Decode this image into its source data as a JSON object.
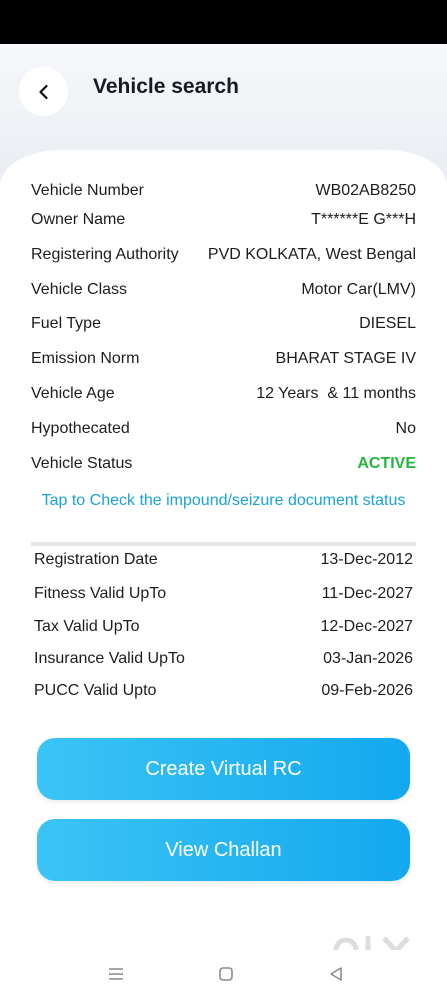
{
  "header": {
    "title": "Vehicle search"
  },
  "details": [
    {
      "label": "Vehicle Number",
      "value": "WB02AB8250"
    },
    {
      "label": "Owner Name",
      "value": "T******E G***H"
    },
    {
      "label": "Registering Authority",
      "value": "PVD KOLKATA, West Bengal"
    },
    {
      "label": "Vehicle Class",
      "value": "Motor Car(LMV)"
    },
    {
      "label": "Fuel Type",
      "value": "DIESEL"
    },
    {
      "label": "Emission Norm",
      "value": "BHARAT STAGE IV"
    },
    {
      "label": "Vehicle Age",
      "value": "12 Years  & 11 months"
    },
    {
      "label": "Hypothecated",
      "value": "No"
    },
    {
      "label": "Vehicle Status",
      "value": "ACTIVE"
    }
  ],
  "impound_link": "Tap to Check the impound/seizure document status",
  "dates": [
    {
      "label": "Registration Date",
      "value": "13-Dec-2012"
    },
    {
      "label": "Fitness Valid UpTo",
      "value": "11-Dec-2027"
    },
    {
      "label": "Tax Valid UpTo",
      "value": "12-Dec-2027"
    },
    {
      "label": "Insurance Valid UpTo",
      "value": "03-Jan-2026"
    },
    {
      "label": "PUCC Valid Upto",
      "value": "09-Feb-2026"
    }
  ],
  "buttons": {
    "virtual_rc": "Create Virtual RC",
    "challan": "View Challan"
  },
  "colors": {
    "status_active": "#25b53a",
    "link": "#1aa2d8",
    "button": "#1aaef2"
  },
  "watermark": "OLX"
}
